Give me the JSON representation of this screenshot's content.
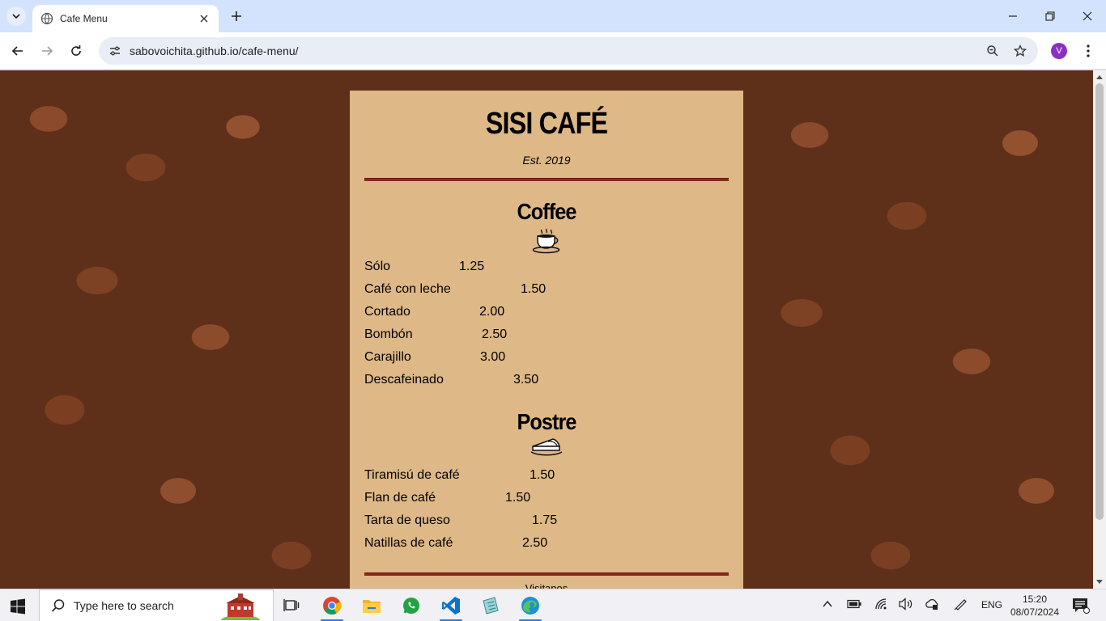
{
  "browser": {
    "tab_title": "Cafe Menu",
    "url": "sabovoichita.github.io/cafe-menu/",
    "profile_initial": "V"
  },
  "menu": {
    "title": "SISI CAFÉ",
    "established": "Est. 2019",
    "coffee": {
      "heading": "Coffee",
      "icon": "coffee-cup-icon",
      "items": [
        {
          "name": "Sólo",
          "price": "1.25"
        },
        {
          "name": "Café con leche",
          "price": "1.50"
        },
        {
          "name": "Cortado",
          "price": "2.00"
        },
        {
          "name": "Bombón",
          "price": "2.50"
        },
        {
          "name": "Carajillo",
          "price": "3.00"
        },
        {
          "name": "Descafeinado",
          "price": "3.50"
        }
      ]
    },
    "postre": {
      "heading": "Postre",
      "icon": "pie-slice-icon",
      "items": [
        {
          "name": "Tiramisú de café",
          "price": "1.50"
        },
        {
          "name": "Flan de café",
          "price": "1.50"
        },
        {
          "name": "Tarta de queso",
          "price": "1.75"
        },
        {
          "name": "Natillas de café",
          "price": "2.50"
        }
      ]
    },
    "footer_text": "Visitanos"
  },
  "taskbar": {
    "search_placeholder": "Type here to search",
    "language": "ENG",
    "time": "15:20",
    "date": "08/07/2024"
  },
  "colors": {
    "menu_background": "#deb887",
    "rule": "#8b2a1a",
    "tab_strip": "#d3e3fd",
    "profile": "#8b2fc9"
  }
}
